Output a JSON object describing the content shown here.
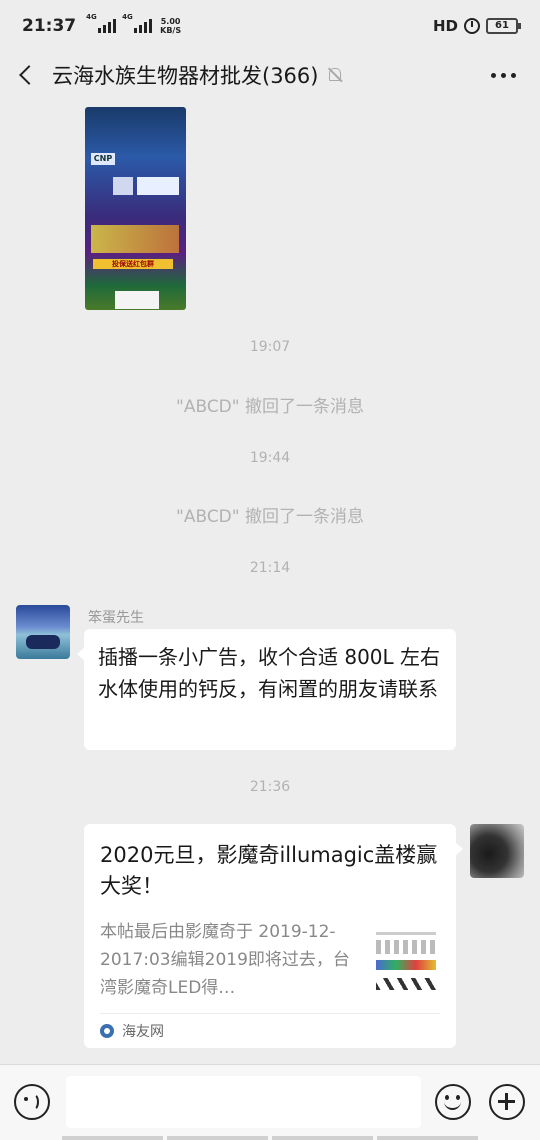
{
  "status_bar": {
    "time": "21:37",
    "sim1": "4G",
    "sim2": "4G",
    "net_speed_value": "5.00",
    "net_speed_unit": "KB/S",
    "hd": "HD",
    "battery": "61"
  },
  "header": {
    "title": "云海水族生物器材批发(366)"
  },
  "messages": {
    "poster_text_1": "CNP",
    "poster_text_2": "投保送红包群",
    "time_1": "19:07",
    "recall_1": "\"ABCD\" 撤回了一条消息",
    "time_2": "19:44",
    "recall_2": "\"ABCD\" 撤回了一条消息",
    "time_3": "21:14",
    "sender_name": "笨蛋先生",
    "text_message": "插播一条小广告，收个合适 800L 左右水体使用的钙反，有闲置的朋友请联系",
    "time_4": "21:36"
  },
  "link_card": {
    "title": "2020元旦，影魔奇illumagic盖楼赢大奖！",
    "description": "本帖最后由影魔奇于 2019-12-2017:03编辑2019即将过去，台湾影魔奇LED得…",
    "source": "海友网"
  },
  "input_bar": {
    "placeholder": ""
  },
  "colors": {
    "background": "#ededed",
    "bubble": "#ffffff",
    "meta_text": "#b2b2b2"
  }
}
